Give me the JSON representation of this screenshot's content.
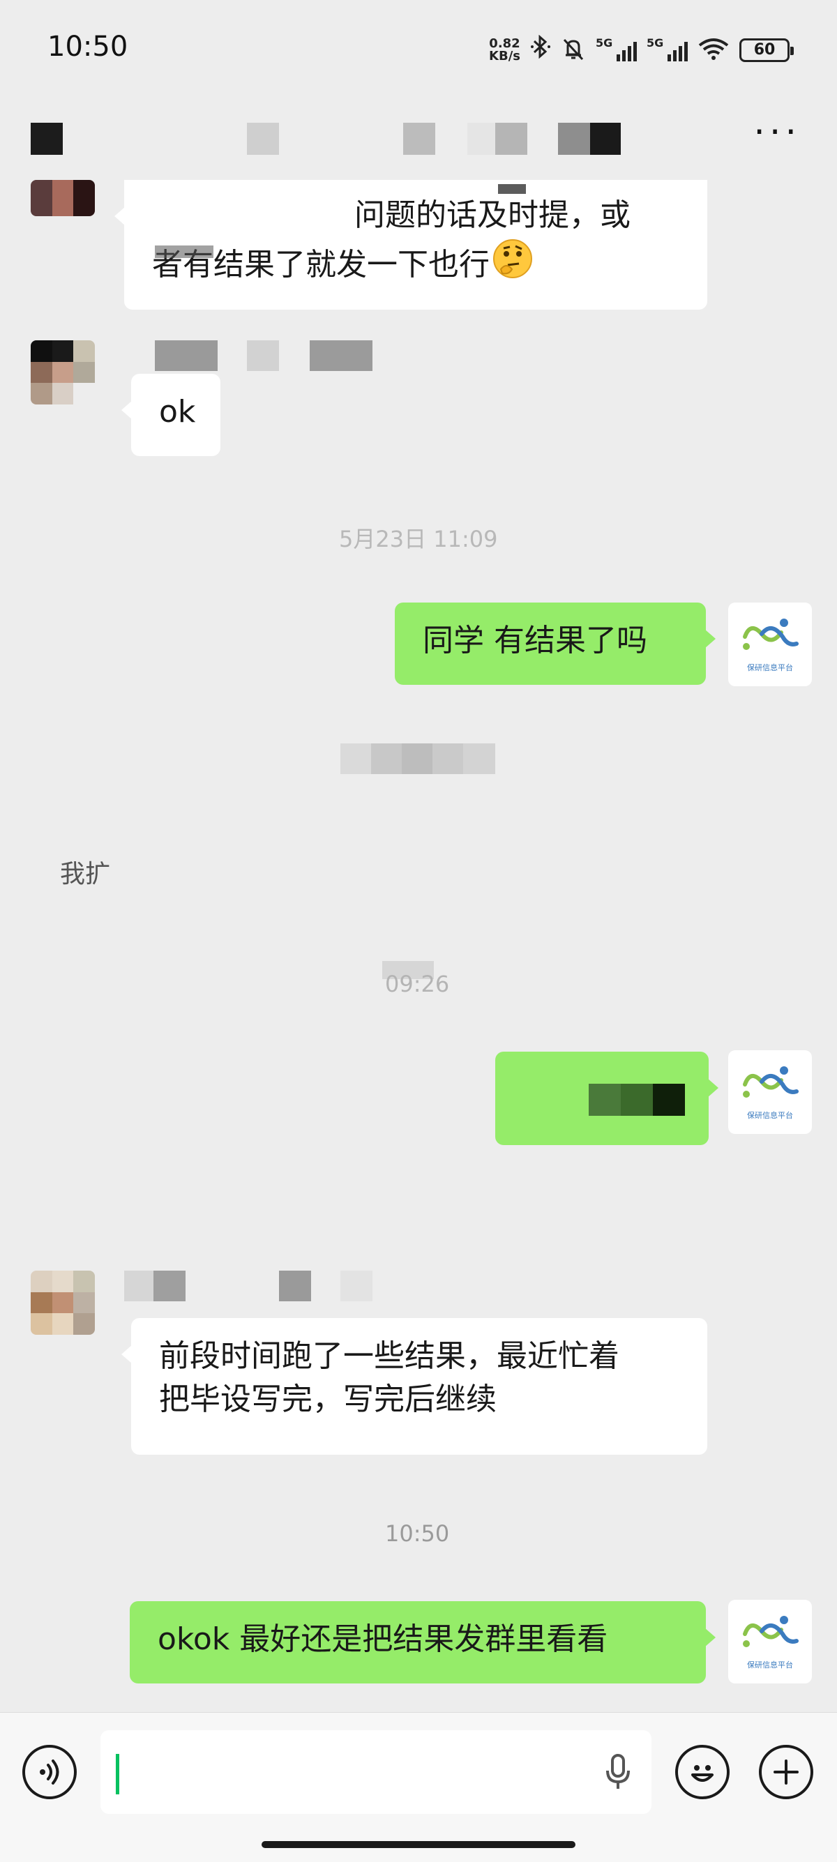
{
  "status_bar": {
    "time": "10:50",
    "net_speed_value": "0.82",
    "net_speed_unit": "KB/s",
    "signal_1_tag": "5G",
    "signal_2_tag": "5G",
    "battery": "60",
    "icons": [
      "bluetooth-icon",
      "mute-bell-icon",
      "signal-icon",
      "signal-icon",
      "wifi-icon",
      "battery-icon"
    ]
  },
  "header": {
    "more_label": "···"
  },
  "messages": [
    {
      "side": "recv",
      "text": "问题的话及时提，或者有结果了就发一下也行",
      "emoji": "thinking-face"
    },
    {
      "side": "recv",
      "text": "ok"
    },
    {
      "side": "time",
      "text": "5月23日 11:09"
    },
    {
      "side": "sent",
      "text": "同学 有结果了吗"
    },
    {
      "side": "recv-partial",
      "text": "我扩"
    },
    {
      "side": "time",
      "text": "09:26"
    },
    {
      "side": "sent",
      "text": ""
    },
    {
      "side": "recv",
      "text": "前段时间跑了一些结果，最近忙着把毕设写完，写完后继续"
    },
    {
      "side": "time",
      "text": "10:50"
    },
    {
      "side": "sent",
      "text": "okok 最好还是把结果发群里看看"
    }
  ],
  "bubble_lines": {
    "m1_line1": "问题的话及时提，或",
    "m1_line2": "者有结果了就发一下也行",
    "m2": "ok",
    "t1": "5月23日 11:09",
    "m3": "同学 有结果了吗",
    "sys1": "我扩",
    "t2": "09:26",
    "m5_line1": "前段时间跑了一些结果，最近忙着",
    "m5_line2": "把毕设写完，写完后继续",
    "t3": "10:50",
    "m6": "okok 最好还是把结果发群里看看"
  },
  "avatar_caption": "保研信息平台",
  "colors": {
    "background": "#ededed",
    "sent_bubble": "#95ec69",
    "recv_bubble": "#ffffff",
    "caret": "#07c160",
    "logo_green": "#8bc34a",
    "logo_blue": "#3b7bbf"
  }
}
